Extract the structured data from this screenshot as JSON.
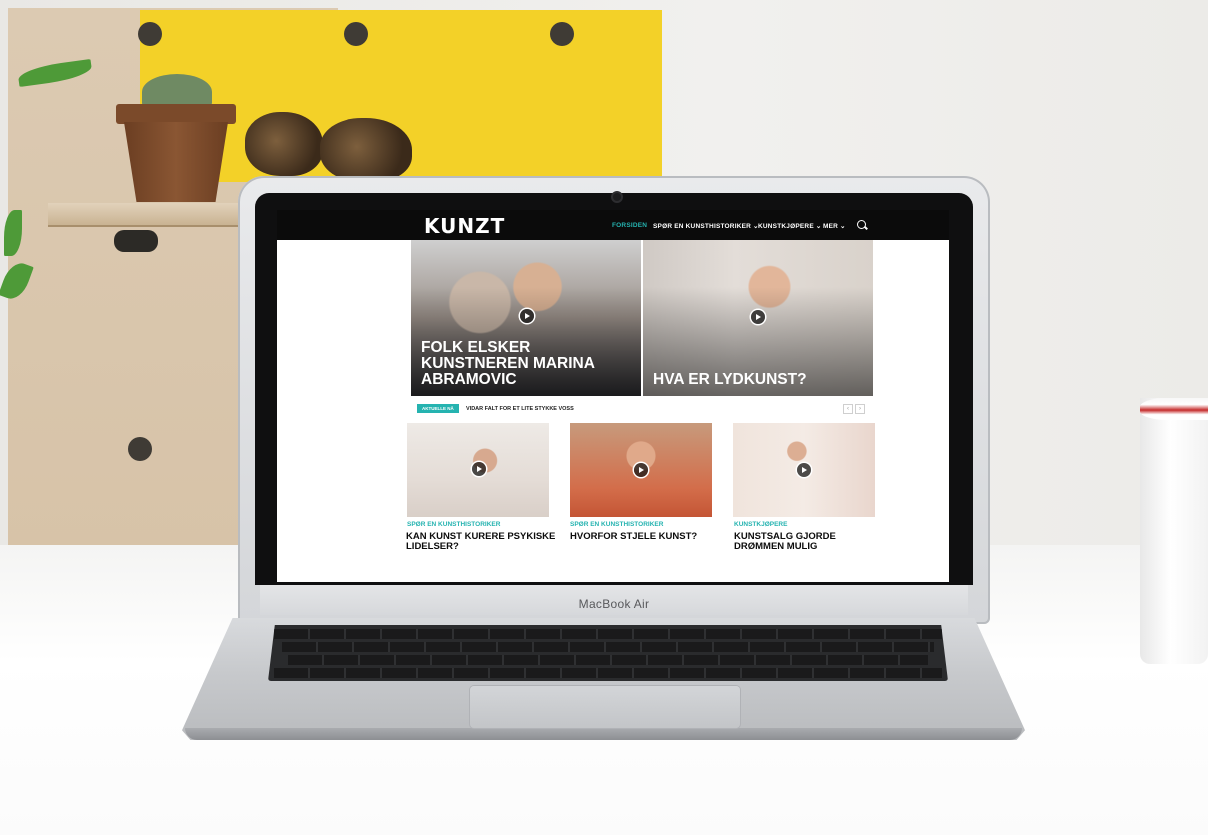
{
  "device": {
    "model_label": "MacBook Air"
  },
  "site": {
    "logo": "KUNZT",
    "accent_color": "#25b3b0",
    "nav": [
      {
        "label": "FORSIDEN",
        "active": true
      },
      {
        "label": "SPØR EN KUNSTHISTORIKER ⌄",
        "active": false
      },
      {
        "label": "KUNSTKJØPERE ⌄",
        "active": false
      },
      {
        "label": "MER ⌄",
        "active": false
      }
    ],
    "search_icon": "search-icon",
    "hero": [
      {
        "title": "FOLK ELSKER KUNSTNEREN MARINA ABRAMOVIC",
        "icon": "play-icon"
      },
      {
        "title": "HVA ER LYDKUNST?",
        "icon": "play-icon"
      }
    ],
    "ticker": {
      "badge": "AKTUELLE NÅ",
      "text": "VIDAR FALT FOR ET LITE STYKKE VOSS",
      "prev": "‹",
      "next": "›"
    },
    "cards": [
      {
        "category": "SPØR EN KUNSTHISTORIKER",
        "title": "KAN KUNST KURERE PSYKISKE LIDELSER?",
        "icon": "play-icon"
      },
      {
        "category": "SPØR EN KUNSTHISTORIKER",
        "title": "HVORFOR STJELE KUNST?",
        "icon": "play-icon"
      },
      {
        "category": "KUNSTKJØPERE",
        "title": "KUNSTSALG GJORDE DRØMMEN MULIG",
        "icon": "play-icon"
      }
    ]
  }
}
